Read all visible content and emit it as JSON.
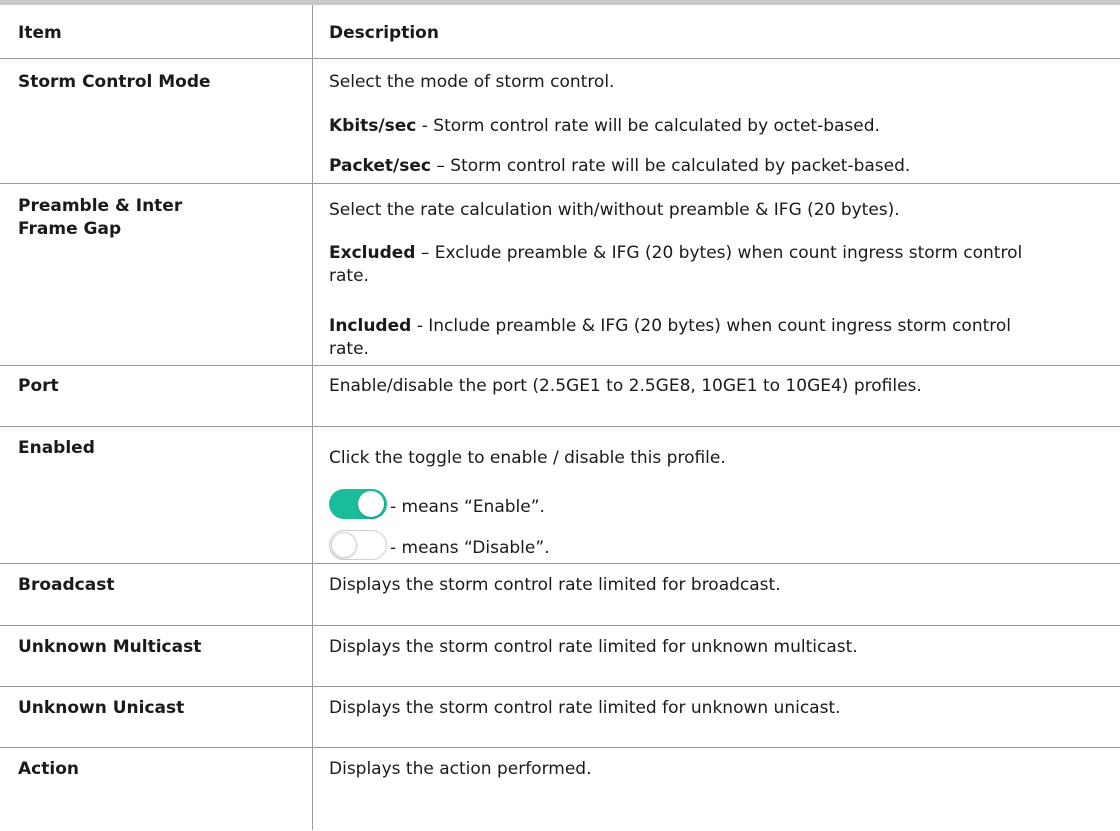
{
  "header": {
    "item": "Item",
    "description": "Description"
  },
  "rows": [
    {
      "item": "Storm Control Mode",
      "lines": [
        {
          "text": "Select the mode of storm control."
        },
        {
          "bold": "Kbits/sec",
          "text": " - Storm control rate will be calculated by octet-based."
        },
        {
          "bold": "Packet/sec",
          "text": " – Storm control rate will be calculated by packet-based."
        }
      ]
    },
    {
      "item": "Preamble & Inter Frame Gap",
      "lines": [
        {
          "text": "Select the rate calculation with/without preamble & IFG (20 bytes)."
        },
        {
          "bold": "Excluded",
          "text": " – Exclude preamble & IFG (20 bytes) when count ingress storm control rate."
        },
        {
          "bold": "Included",
          "text": " - Include preamble & IFG (20 bytes) when count ingress storm control rate."
        }
      ]
    },
    {
      "item": "Port",
      "lines": [
        {
          "text": "Enable/disable the port (2.5GE1 to 2.5GE8, 10GE1 to 10GE4) profiles."
        }
      ]
    },
    {
      "item": "Enabled",
      "lines": [
        {
          "text": "Click the toggle to enable / disable this profile."
        },
        {
          "text": "- means “Enable”.",
          "icon": "toggle-on-icon"
        },
        {
          "text": "- means “Disable”.",
          "icon": "toggle-off-icon"
        }
      ]
    },
    {
      "item": "Broadcast",
      "lines": [
        {
          "text": "Displays the storm control rate limited for broadcast."
        }
      ]
    },
    {
      "item": "Unknown Multicast",
      "lines": [
        {
          "text": "Displays the storm control rate limited for unknown multicast."
        }
      ]
    },
    {
      "item": "Unknown Unicast",
      "lines": [
        {
          "text": "Displays the storm control rate limited for unknown unicast."
        }
      ]
    },
    {
      "item": "Action",
      "lines": [
        {
          "text": "Displays the action performed."
        }
      ]
    }
  ],
  "colors": {
    "toggle_on": "#1abc9c",
    "toggle_off_border": "#cfcfcf",
    "rule": "#9a9a9a",
    "top_rule": "#c9c9c9"
  }
}
